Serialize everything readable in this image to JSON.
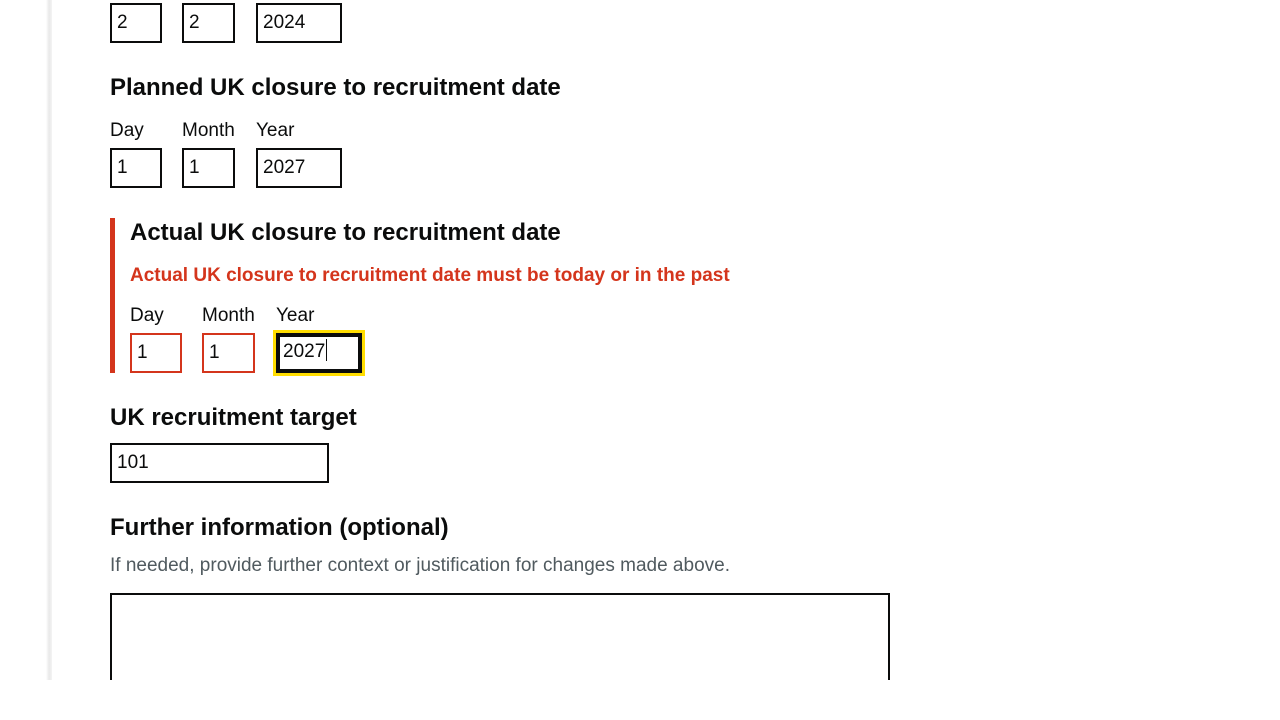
{
  "top_date": {
    "day": "2",
    "month": "2",
    "year": "2024"
  },
  "planned_closure": {
    "heading": "Planned UK closure to recruitment date",
    "day_label": "Day",
    "month_label": "Month",
    "year_label": "Year",
    "day": "1",
    "month": "1",
    "year": "2027"
  },
  "actual_closure": {
    "heading": "Actual UK closure to recruitment date",
    "error": "Actual UK closure to recruitment date must be today or in the past",
    "day_label": "Day",
    "month_label": "Month",
    "year_label": "Year",
    "day": "1",
    "month": "1",
    "year": "2027"
  },
  "recruitment_target": {
    "heading": "UK recruitment target",
    "value": "101"
  },
  "further_info": {
    "heading": "Further information (optional)",
    "hint": "If needed, provide further context or justification for changes made above.",
    "value": ""
  },
  "colors": {
    "error": "#d4351c",
    "focus": "#ffdd00",
    "text": "#0b0c0c",
    "hint": "#505a5f"
  }
}
